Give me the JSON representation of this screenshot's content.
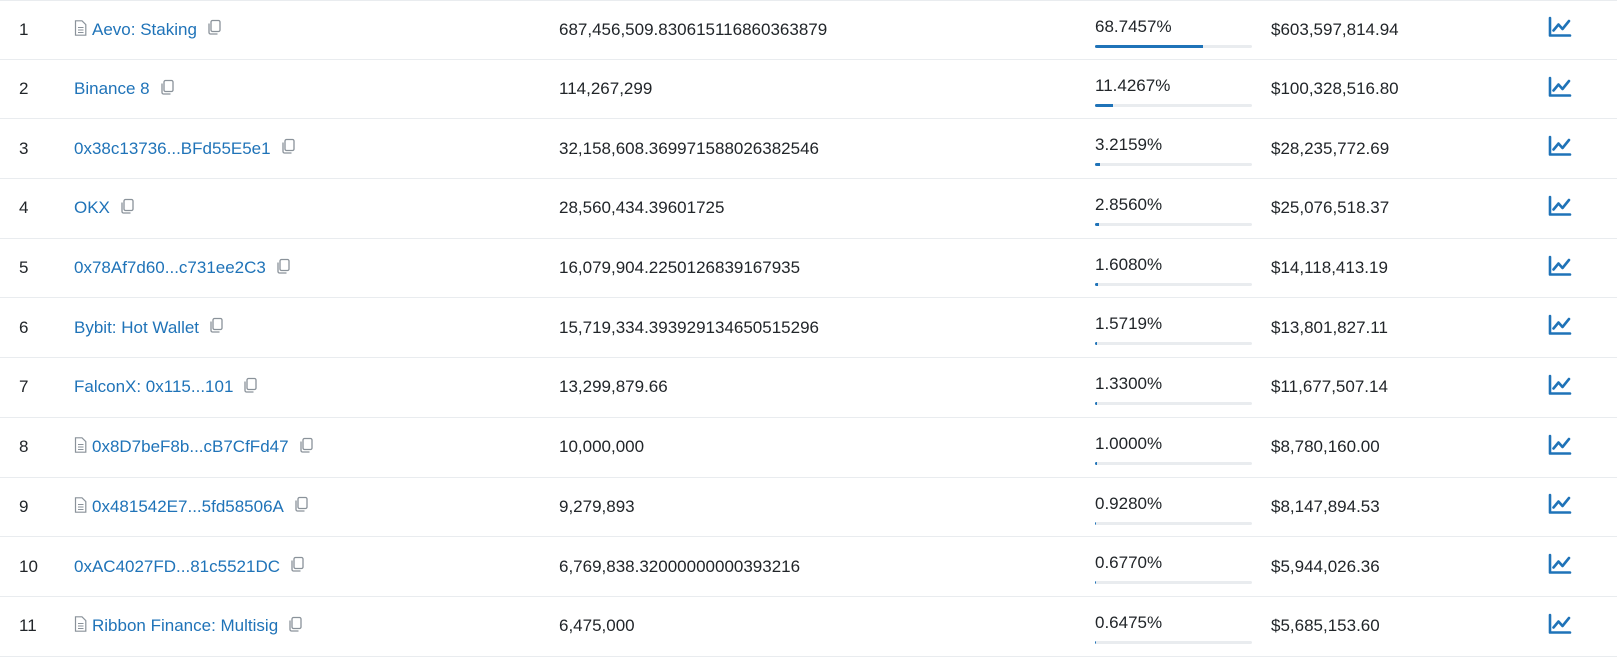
{
  "accent_color": "#1f73b8",
  "holders": [
    {
      "rank": "1",
      "address": "Aevo: Staking",
      "is_contract": true,
      "quantity": "687,456,509.830615116860363879",
      "percentage": "68.7457%",
      "pct_value": 68.7457,
      "value": "$603,597,814.94"
    },
    {
      "rank": "2",
      "address": "Binance 8",
      "is_contract": false,
      "quantity": "114,267,299",
      "percentage": "11.4267%",
      "pct_value": 11.4267,
      "value": "$100,328,516.80"
    },
    {
      "rank": "3",
      "address": "0x38c13736...BFd55E5e1",
      "is_contract": false,
      "quantity": "32,158,608.369971588026382546",
      "percentage": "3.2159%",
      "pct_value": 3.2159,
      "value": "$28,235,772.69"
    },
    {
      "rank": "4",
      "address": "OKX",
      "is_contract": false,
      "quantity": "28,560,434.39601725",
      "percentage": "2.8560%",
      "pct_value": 2.856,
      "value": "$25,076,518.37"
    },
    {
      "rank": "5",
      "address": "0x78Af7d60...c731ee2C3",
      "is_contract": false,
      "quantity": "16,079,904.2250126839167935",
      "percentage": "1.6080%",
      "pct_value": 1.608,
      "value": "$14,118,413.19"
    },
    {
      "rank": "6",
      "address": "Bybit: Hot Wallet",
      "is_contract": false,
      "quantity": "15,719,334.393929134650515296",
      "percentage": "1.5719%",
      "pct_value": 1.5719,
      "value": "$13,801,827.11"
    },
    {
      "rank": "7",
      "address": "FalconX: 0x115...101",
      "is_contract": false,
      "quantity": "13,299,879.66",
      "percentage": "1.3300%",
      "pct_value": 1.33,
      "value": "$11,677,507.14"
    },
    {
      "rank": "8",
      "address": "0x8D7beF8b...cB7CfFd47",
      "is_contract": true,
      "quantity": "10,000,000",
      "percentage": "1.0000%",
      "pct_value": 1.0,
      "value": "$8,780,160.00"
    },
    {
      "rank": "9",
      "address": "0x481542E7...5fd58506A",
      "is_contract": true,
      "quantity": "9,279,893",
      "percentage": "0.9280%",
      "pct_value": 0.928,
      "value": "$8,147,894.53"
    },
    {
      "rank": "10",
      "address": "0xAC4027FD...81c5521DC",
      "is_contract": false,
      "quantity": "6,769,838.32000000000393216",
      "percentage": "0.6770%",
      "pct_value": 0.677,
      "value": "$5,944,026.36"
    },
    {
      "rank": "11",
      "address": "Ribbon Finance: Multisig",
      "is_contract": true,
      "quantity": "6,475,000",
      "percentage": "0.6475%",
      "pct_value": 0.6475,
      "value": "$5,685,153.60"
    }
  ]
}
